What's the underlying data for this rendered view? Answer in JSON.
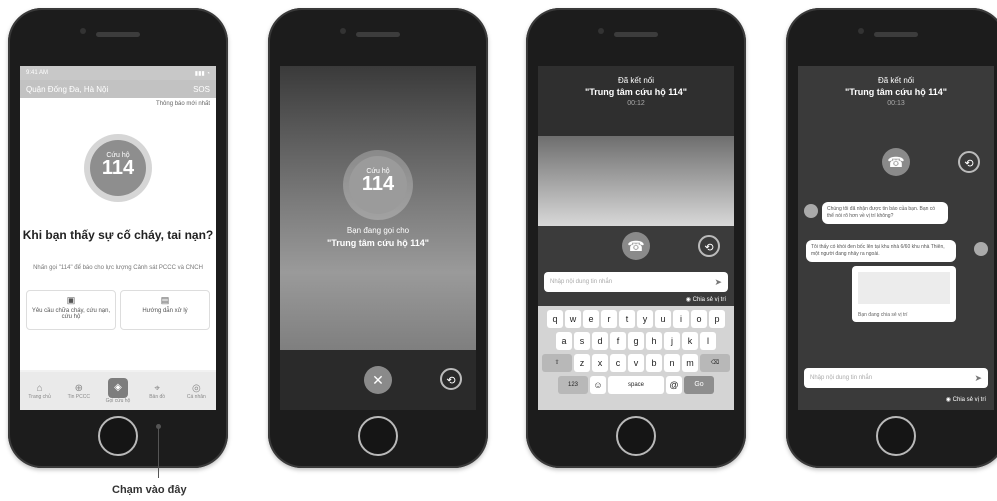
{
  "phone1": {
    "status_time": "9:41 AM",
    "status_right": "▮▮▮ ◔",
    "location": "Quận Đống Đa, Hà Nội",
    "sos_label": "SOS",
    "notification_link": "Thông báo mới nhất",
    "badge_small": "Cứu hộ",
    "badge_number": "114",
    "headline": "Khi bạn thấy sự cố cháy, tai nạn?",
    "sub_text": "Nhấn gọi \"114\" để báo cho lực lượng Cảnh sát PCCC và CNCH",
    "cards": [
      {
        "icon": "fire-icon",
        "label": "Yêu cầu chữa cháy, cứu nạn, cứu hộ"
      },
      {
        "icon": "guide-icon",
        "label": "Hướng dẫn xử lý"
      }
    ],
    "tabs": [
      "Trang chủ",
      "Tin PCCC",
      "Gọi cứu hộ",
      "Bản đồ",
      "Cá nhân"
    ]
  },
  "phone2": {
    "badge_small": "Cứu hộ",
    "badge_number": "114",
    "calling_text": "Bạn đang gọi cho",
    "calling_target": "\"Trung tâm cứu hộ 114\""
  },
  "phone3": {
    "connected_text": "Đã kết nối",
    "target": "\"Trung tâm cứu hộ 114\"",
    "timer": "00:12",
    "message_placeholder": "Nhập nội dung tin nhắn",
    "share_location": "Chia sẻ vị trí",
    "keyboard": {
      "row1": [
        "q",
        "w",
        "e",
        "r",
        "t",
        "y",
        "u",
        "i",
        "o",
        "p"
      ],
      "row2": [
        "a",
        "s",
        "d",
        "f",
        "g",
        "h",
        "j",
        "k",
        "l"
      ],
      "row3": [
        "z",
        "x",
        "c",
        "v",
        "b",
        "n",
        "m"
      ],
      "num_key": "123",
      "space_key": "space",
      "go_key": "Go",
      "at_key": "@"
    }
  },
  "phone4": {
    "connected_text": "Đã kết nối",
    "target": "\"Trung tâm cứu hộ 114\"",
    "timer": "00:13",
    "bubble1": "Chúng tôi đã nhận được tin báo của bạn. Bạn có thể nói rõ hơn về vị trí không?",
    "bubble2": "Tôi thấy có khói đen bốc lên tại khu nhà 6/60 khu nhà Thiên, một người đang nhảy ra ngoài.",
    "photo_caption": "Bạn đang chia sẻ vị trí",
    "message_placeholder": "Nhập nội dung tin nhắn",
    "share_location": "Chia sẻ vị trí"
  },
  "caption": "Chạm vào đây"
}
